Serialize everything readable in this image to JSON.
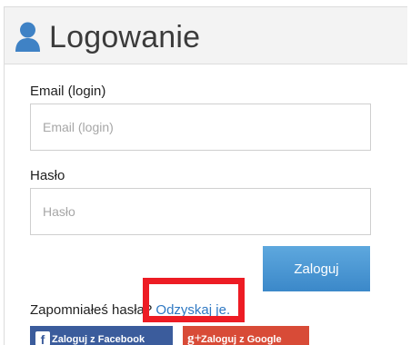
{
  "header": {
    "title": "Logowanie",
    "icon": "user-icon"
  },
  "form": {
    "email_label": "Email (login)",
    "email_placeholder": "Email (login)",
    "email_value": "",
    "password_label": "Hasło",
    "password_placeholder": "Hasło",
    "password_value": "",
    "submit_label": "Zaloguj"
  },
  "recovery": {
    "prompt": "Zapomniałeś hasła?",
    "link_label": "Odzyskaj je."
  },
  "social": {
    "facebook_label": "Zaloguj z Facebook",
    "facebook_icon": "f",
    "google_label": "Zaloguj z Google",
    "google_icon": "g+"
  },
  "colors": {
    "header_background": "#f3f3f3",
    "accent_blue": "#3b88c9",
    "link_blue": "#2e78c3",
    "highlight_red": "#ed1c24",
    "facebook_blue": "#3b5c9c",
    "google_red": "#d84b37"
  }
}
